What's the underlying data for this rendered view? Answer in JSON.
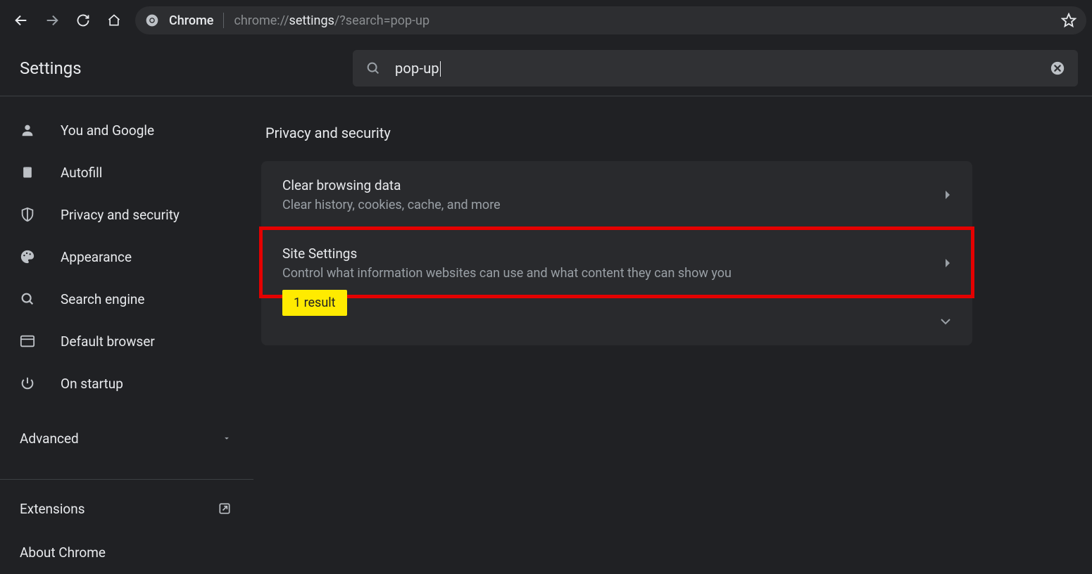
{
  "omnibox": {
    "label": "Chrome",
    "url_prefix": "chrome://",
    "url_bold": "settings",
    "url_suffix": "/?search=pop-up"
  },
  "header": {
    "title": "Settings",
    "search_value": "pop-up"
  },
  "sidebar": {
    "items": [
      {
        "label": "You and Google"
      },
      {
        "label": "Autofill"
      },
      {
        "label": "Privacy and security"
      },
      {
        "label": "Appearance"
      },
      {
        "label": "Search engine"
      },
      {
        "label": "Default browser"
      },
      {
        "label": "On startup"
      }
    ],
    "advanced": "Advanced",
    "extensions": "Extensions",
    "about": "About Chrome"
  },
  "main": {
    "section_title": "Privacy and security",
    "rows": [
      {
        "title": "Clear browsing data",
        "sub": "Clear history, cookies, cache, and more"
      },
      {
        "title": "Site Settings",
        "sub": "Control what information websites can use and what content they can show you"
      }
    ],
    "result_badge": "1 result"
  }
}
